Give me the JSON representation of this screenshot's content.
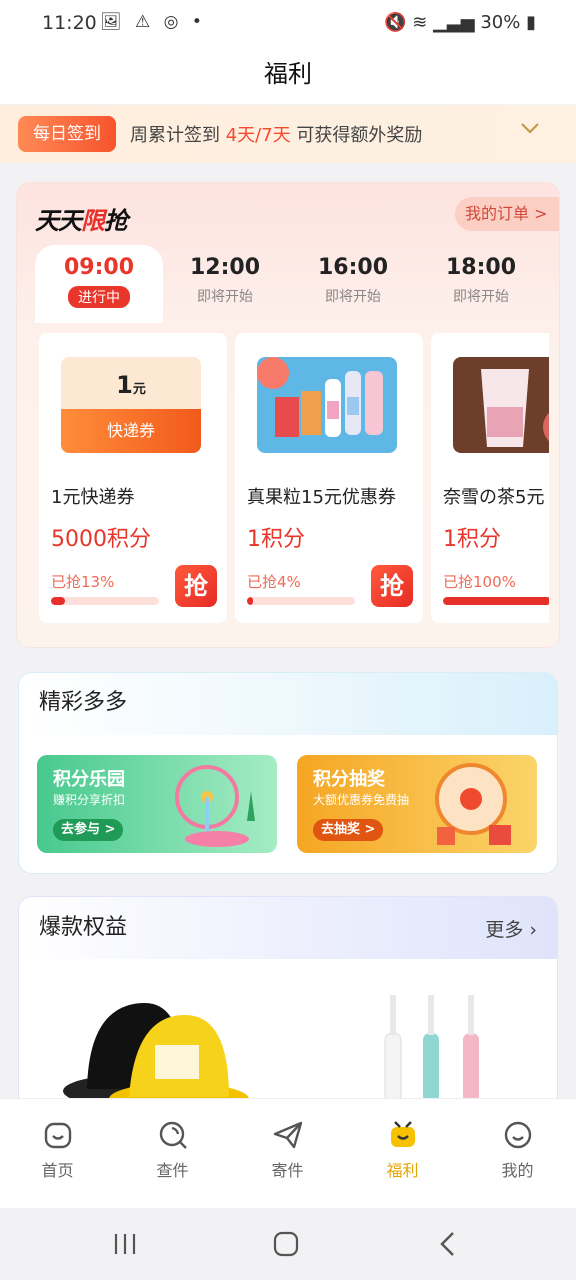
{
  "status": {
    "time": "11:20",
    "battery": "30%"
  },
  "header": {
    "title": "福利"
  },
  "signin": {
    "badge": "每日签到",
    "prefix": "周累计签到 ",
    "progress": "4天/7天",
    "suffix": " 可获得额外奖励"
  },
  "flash": {
    "logo_a": "天天",
    "logo_b": "限",
    "logo_c": "抢",
    "orders": "我的订单 >",
    "tabs": [
      {
        "time": "09:00",
        "status": "进行中"
      },
      {
        "time": "12:00",
        "status": "即将开始"
      },
      {
        "time": "16:00",
        "status": "即将开始"
      },
      {
        "time": "18:00",
        "status": "即将开始"
      }
    ],
    "items": [
      {
        "name": "1元快递券",
        "points": "5000积分",
        "sold": "已抢13%",
        "progress": 0.13,
        "coupon_value": "1",
        "coupon_unit": "元",
        "coupon_label": "快递券",
        "grab": "抢"
      },
      {
        "name": "真果粒15元优惠券",
        "points": "1积分",
        "sold": "已抢4%",
        "progress": 0.04,
        "grab": "抢"
      },
      {
        "name": "奈雪の茶5元",
        "points": "1积分",
        "sold": "已抢100%",
        "progress": 1.0
      }
    ]
  },
  "activities": {
    "title": "精彩多多",
    "promos": [
      {
        "title": "积分乐园",
        "subtitle": "赚积分享折扣",
        "button": "去参与 >"
      },
      {
        "title": "积分抽奖",
        "subtitle": "大额优惠券免费抽",
        "button": "去抽奖 >"
      }
    ]
  },
  "benefits": {
    "title": "爆款权益",
    "more": "更多"
  },
  "nav": [
    {
      "label": "首页",
      "icon": "home-icon"
    },
    {
      "label": "查件",
      "icon": "search-icon"
    },
    {
      "label": "寄件",
      "icon": "send-icon"
    },
    {
      "label": "福利",
      "icon": "gift-icon"
    },
    {
      "label": "我的",
      "icon": "profile-icon"
    }
  ],
  "colors": {
    "accent": "#e8362b",
    "nav_active": "#e6a600"
  }
}
